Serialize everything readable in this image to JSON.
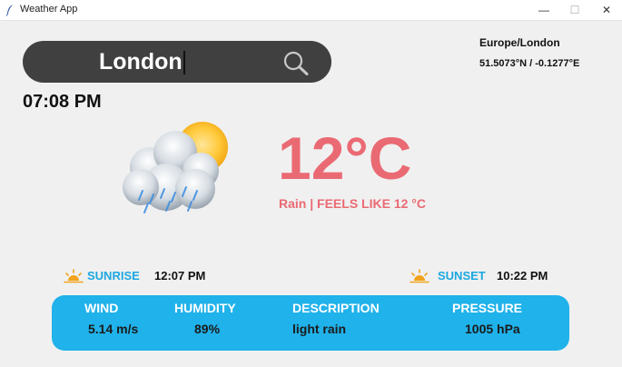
{
  "window": {
    "title": "Weather App",
    "minimize_glyph": "—",
    "maximize_glyph": "☐",
    "close_glyph": "✕"
  },
  "search": {
    "value": "London",
    "icon": "search-icon"
  },
  "location": {
    "timezone": "Europe/London",
    "coordinates": "51.5073°N / -0.1277°E"
  },
  "time": "07:08 PM",
  "weather": {
    "icon": "cloud-rain-sun-icon",
    "temperature": "12°C",
    "condition_line": "Rain | FEELS LIKE 12 °C"
  },
  "sun": {
    "sunrise_label": "SUNRISE",
    "sunrise_time": "12:07 PM",
    "sunset_label": "SUNSET",
    "sunset_time": "10:22 PM"
  },
  "details": {
    "wind_label": "WIND",
    "wind_value": "5.14 m/s",
    "humidity_label": "HUMIDITY",
    "humidity_value": "89%",
    "description_label": "DESCRIPTION",
    "description_value": "light rain",
    "pressure_label": "PRESSURE",
    "pressure_value": "1005 hPa"
  },
  "colors": {
    "accent_temp": "#ea6a73",
    "panel_blue": "#20b2ea",
    "sun_label_blue": "#1ba7e0",
    "sun_orange": "#f2a31c"
  }
}
